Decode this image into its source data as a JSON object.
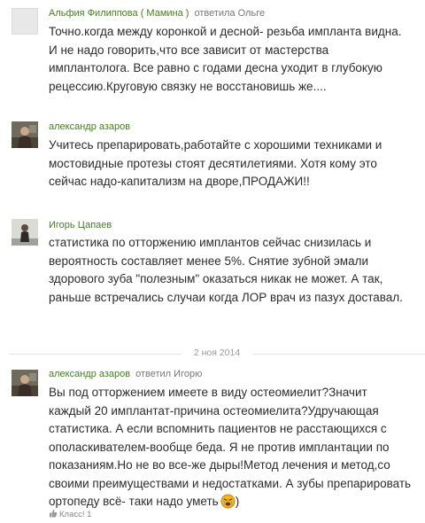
{
  "comments": [
    {
      "author": "Альфия Филиппова ( Мамина )",
      "reply_verb": "ответила",
      "reply_target": "Ольге",
      "text": "Точно.когда между коронкой и десной- резьба импланта видна. И не надо говорить,что все зависит от мастерства имплантолога. Все равно с годами десна уходит в глубокую рецессию.Круговую связку не восстановишь же...."
    },
    {
      "author": "александр азаров",
      "text": "Учитесь препарировать,работайте с хорошими техниками и мостовидные протезы стоят десятилетиями. Хотя кому это сейчас надо-капитализм на дворе,ПРОДАЖИ!!"
    },
    {
      "author": "Игорь Цапаев",
      "text": "статистика по отторжению имплантов сейчас снизилась и вероятность составляет менее 5%. Снятие зубной эмали здорового зуба \"полезным\" оказаться никак не может. А так, раньше встречались случаи когда ЛОР врач из пазух доставал."
    },
    {
      "author": "александр азаров",
      "reply_verb": "ответил",
      "reply_target": "Игорю",
      "text": "Вы под отторжением имеете в виду остеомиелит?Значит каждый 20 имплантат-причина остеомиелита?Удручающая статистика. А если вспомнить пациентов не расстающихся с ополаскивателем-вообще беда. Я не против имплантации по показаниям.Но не во все-же дыры!Метод лечения и метод,со своими преимуществами и недостатками. А зубы препарировать ортопеду всё- таки надо уметь",
      "text_tail": ")"
    }
  ],
  "date_divider": "2 ноя 2014",
  "klass": {
    "label": "Класс!",
    "count": "1"
  },
  "icons": {
    "smile": "crying-smiley-icon",
    "klass": "thumbs-up-icon"
  },
  "colors": {
    "author": "#467e1f",
    "text": "#2c2c2c",
    "meta": "#777777"
  }
}
